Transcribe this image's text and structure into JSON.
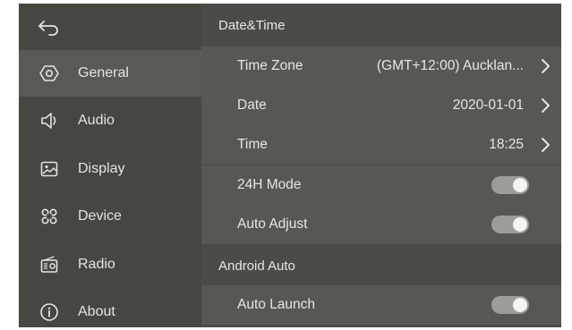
{
  "sidebar": {
    "items": [
      {
        "label": "General",
        "icon": "hexagon-settings-icon",
        "selected": true
      },
      {
        "label": "Audio",
        "icon": "speaker-icon",
        "selected": false
      },
      {
        "label": "Display",
        "icon": "picture-icon",
        "selected": false
      },
      {
        "label": "Device",
        "icon": "command-key-icon",
        "selected": false
      },
      {
        "label": "Radio",
        "icon": "radio-icon",
        "selected": false
      },
      {
        "label": "About",
        "icon": "info-icon",
        "selected": false
      }
    ]
  },
  "sections": [
    {
      "title": "Date&Time",
      "rows": [
        {
          "label": "Time Zone",
          "value": "(GMT+12:00) Aucklan...",
          "type": "link"
        },
        {
          "label": "Date",
          "value": "2020-01-01",
          "type": "link"
        },
        {
          "label": "Time",
          "value": "18:25",
          "type": "link"
        },
        {
          "label": "24H Mode",
          "type": "toggle",
          "on": true
        },
        {
          "label": "Auto Adjust",
          "type": "toggle",
          "on": true
        }
      ]
    },
    {
      "title": "Android Auto",
      "rows": [
        {
          "label": "Auto Launch",
          "type": "toggle",
          "on": true
        }
      ]
    }
  ],
  "colors": {
    "background": "#4a4c47",
    "sidebar": "#454741",
    "selected": "#585a54",
    "row": "#565853",
    "toggle_track": "#9b9d97",
    "toggle_knob": "#f4f4f1"
  }
}
